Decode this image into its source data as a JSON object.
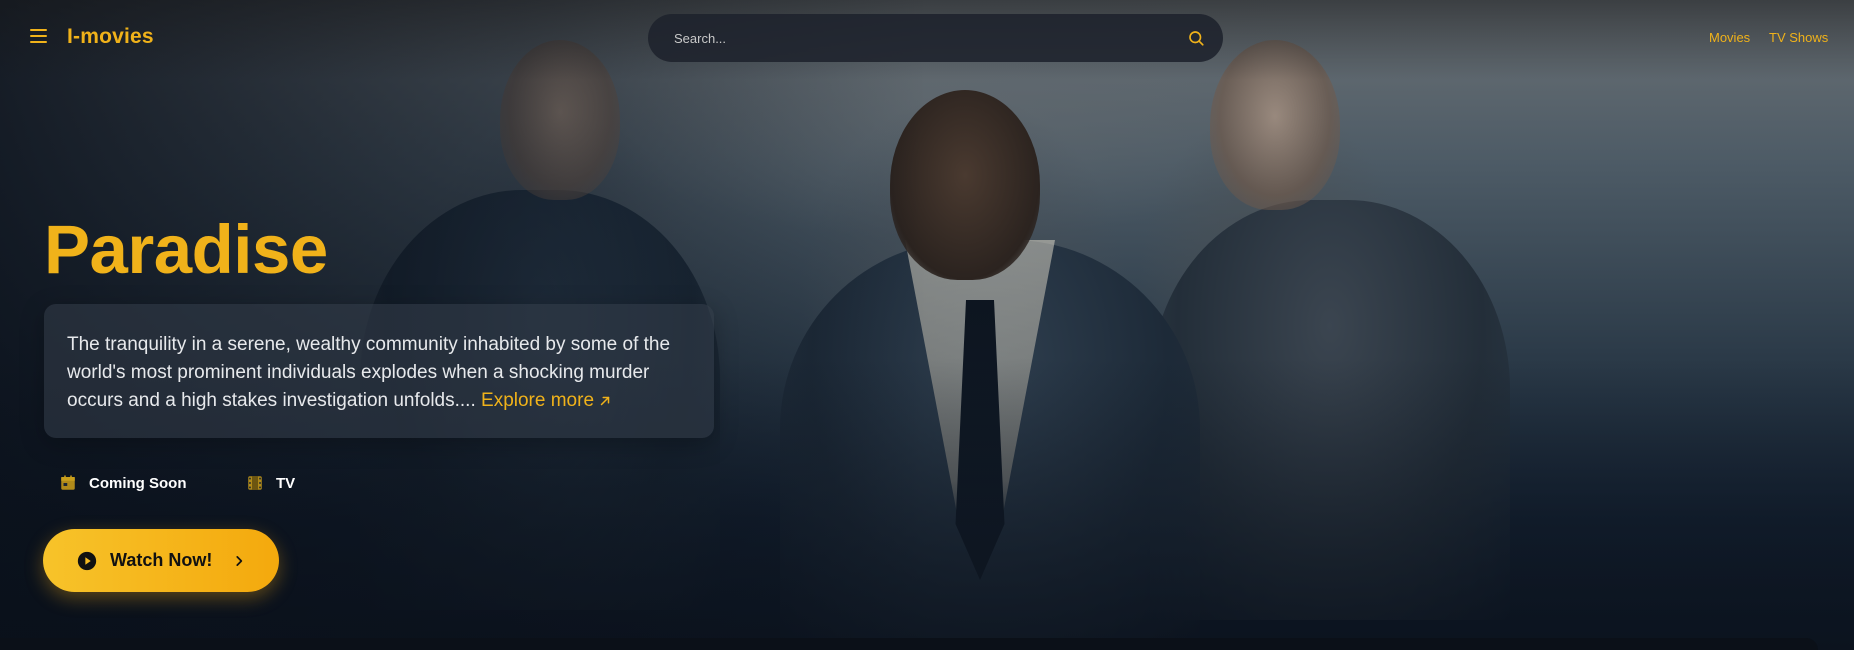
{
  "header": {
    "logo": "I-movies",
    "search_placeholder": "Search...",
    "nav": [
      "Movies",
      "TV Shows"
    ]
  },
  "hero": {
    "title": "Paradise",
    "description": "The tranquility in a serene, wealthy community inhabited by some of the world's most prominent individuals explodes when a shocking murder occurs and a high stakes investigation unfolds....",
    "explore_label": "Explore more",
    "meta": {
      "status": "Coming Soon",
      "type": "TV"
    },
    "watch_label": "Watch Now!"
  },
  "colors": {
    "accent": "#f0b21a",
    "button_start": "#f7c32a",
    "button_end": "#f4a90d"
  },
  "icons": [
    "menu-icon",
    "search-icon",
    "arrow-up-right-icon",
    "calendar-icon",
    "film-icon",
    "play-circle-icon",
    "chevron-right-icon"
  ]
}
